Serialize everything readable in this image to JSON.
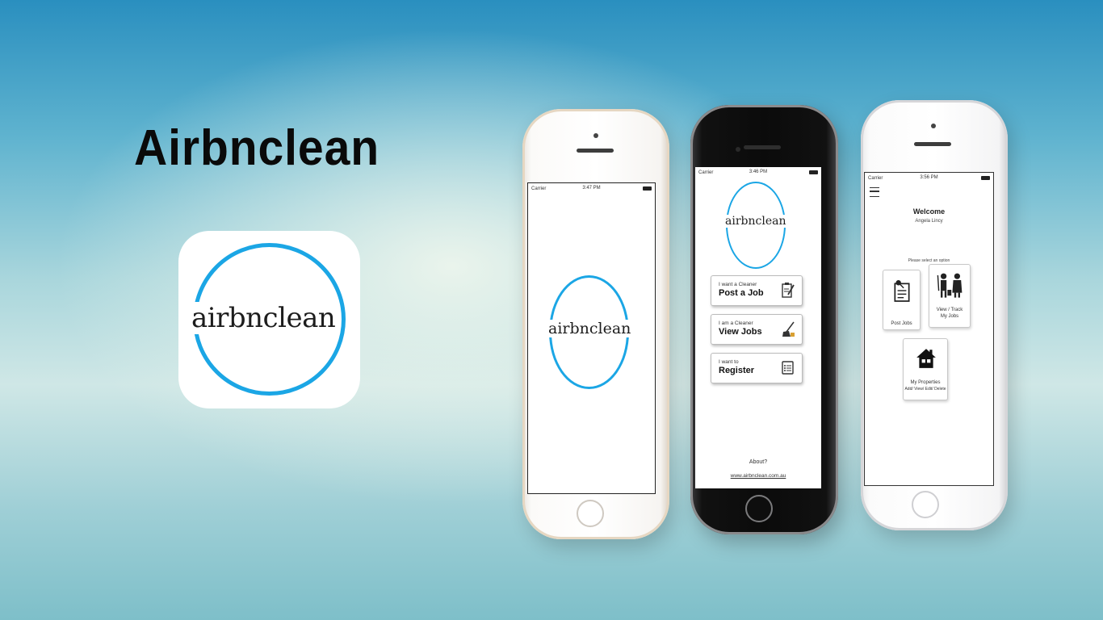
{
  "promo": {
    "title": "Airbnclean",
    "logo_text": "airbnclean"
  },
  "colors": {
    "brand_blue": "#1ba6e5"
  },
  "phone1": {
    "status": {
      "carrier": "Carrier",
      "time": "3:47 PM"
    },
    "logo_text": "airbnclean"
  },
  "phone2": {
    "status": {
      "carrier": "Carrier",
      "time": "3:46 PM"
    },
    "logo_text": "airbnclean",
    "buttons": [
      {
        "small": "I want a Cleaner",
        "big": "Post a Job",
        "icon": "clipboard-pen-icon"
      },
      {
        "small": "I am a Cleaner",
        "big": "View Jobs",
        "icon": "broom-bucket-icon"
      },
      {
        "small": "I want to",
        "big": "Register",
        "icon": "list-form-icon"
      }
    ],
    "about": "About?",
    "website": "www.airbnclean.com.au"
  },
  "phone3": {
    "status": {
      "carrier": "Carrier",
      "time": "3:56 PM"
    },
    "welcome": "Welcome",
    "user_name": "Angela Lincy",
    "prompt": "Please select an option",
    "options": [
      {
        "label": "Post Jobs",
        "icon": "pushpin-note-icon"
      },
      {
        "label": "View / Track\nMy Jobs",
        "line1": "View / Track",
        "line2": "My Jobs",
        "icon": "cleaners-people-icon"
      },
      {
        "label": "My Properties",
        "sub": "Add/ View/ Edit/ Delete",
        "icon": "house-icon"
      }
    ]
  }
}
